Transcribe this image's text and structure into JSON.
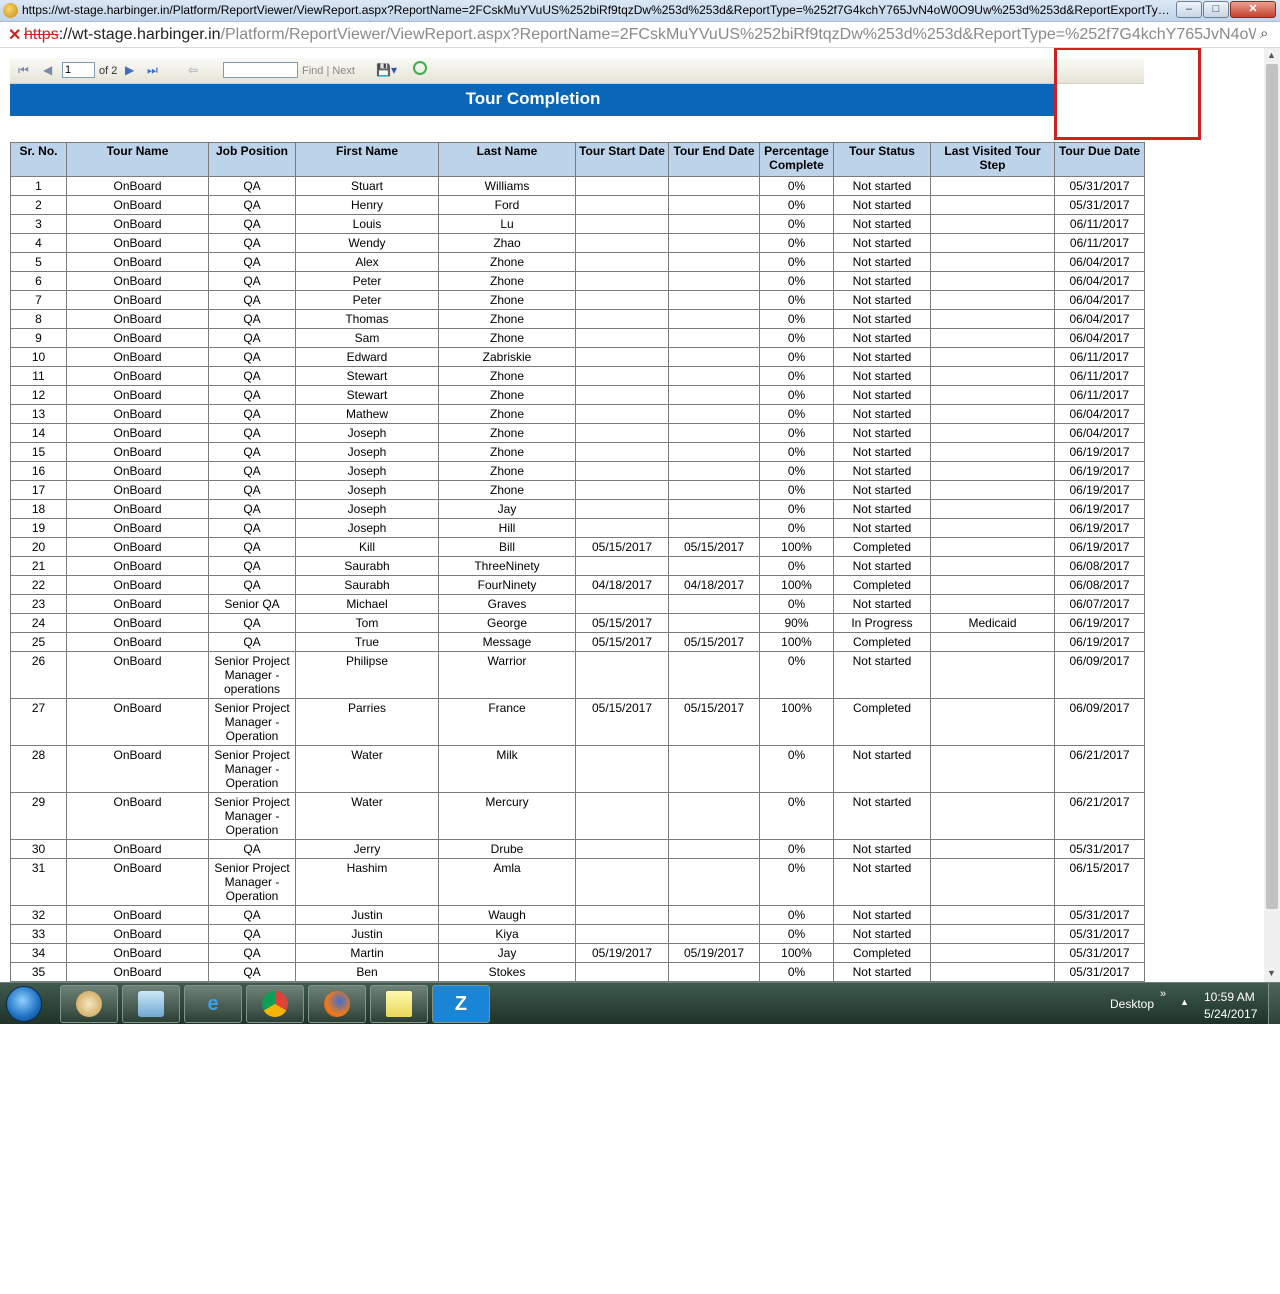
{
  "window": {
    "title": "https://wt-stage.harbinger.in/Platform/ReportViewer/ViewReport.aspx?ReportName=2FCskMuYVuUS%252biRf9tqzDw%253d%253d&ReportType=%252f7G4kchY765JvN4oW0O9Uw%253d%253d&ReportExportType...",
    "minimize": "–",
    "maximize": "□",
    "close": "✕"
  },
  "address_bar": {
    "scheme": "https",
    "host": "://wt-stage.harbinger.in",
    "path": "/Platform/ReportViewer/ViewReport.aspx?ReportName=2FCskMuYVuUS%252biRf9tqzDw%253d%253d&ReportType=%252f7G4kchY765JvN4oW0",
    "warning_icon": "certificate-error-icon",
    "zoom_icon": "magnifier-icon"
  },
  "toolbar": {
    "first": "⏮",
    "prev": "◀",
    "page_value": "1",
    "page_of": "of 2",
    "next": "▶",
    "last": "⏭",
    "back": "⇦",
    "find_next": "Find | Next",
    "export": "💾▾"
  },
  "report": {
    "title": "Tour Completion",
    "headers": [
      "Sr. No.",
      "Tour Name",
      "Job Position",
      "First Name",
      "Last Name",
      "Tour Start Date",
      "Tour End Date",
      "Percentage Complete",
      "Tour Status",
      "Last Visited Tour Step",
      "Tour Due Date"
    ],
    "rows": [
      [
        "1",
        "OnBoard",
        "QA",
        "Stuart",
        "Williams",
        "",
        "",
        "0%",
        "Not started",
        "",
        "05/31/2017"
      ],
      [
        "2",
        "OnBoard",
        "QA",
        "Henry",
        "Ford",
        "",
        "",
        "0%",
        "Not started",
        "",
        "05/31/2017"
      ],
      [
        "3",
        "OnBoard",
        "QA",
        "Louis",
        "Lu",
        "",
        "",
        "0%",
        "Not started",
        "",
        "06/11/2017"
      ],
      [
        "4",
        "OnBoard",
        "QA",
        "Wendy",
        "Zhao",
        "",
        "",
        "0%",
        "Not started",
        "",
        "06/11/2017"
      ],
      [
        "5",
        "OnBoard",
        "QA",
        "Alex",
        "Zhone",
        "",
        "",
        "0%",
        "Not started",
        "",
        "06/04/2017"
      ],
      [
        "6",
        "OnBoard",
        "QA",
        "Peter",
        "Zhone",
        "",
        "",
        "0%",
        "Not started",
        "",
        "06/04/2017"
      ],
      [
        "7",
        "OnBoard",
        "QA",
        "Peter",
        "Zhone",
        "",
        "",
        "0%",
        "Not started",
        "",
        "06/04/2017"
      ],
      [
        "8",
        "OnBoard",
        "QA",
        "Thomas",
        "Zhone",
        "",
        "",
        "0%",
        "Not started",
        "",
        "06/04/2017"
      ],
      [
        "9",
        "OnBoard",
        "QA",
        "Sam",
        "Zhone",
        "",
        "",
        "0%",
        "Not started",
        "",
        "06/04/2017"
      ],
      [
        "10",
        "OnBoard",
        "QA",
        "Edward",
        "Zabriskie",
        "",
        "",
        "0%",
        "Not started",
        "",
        "06/11/2017"
      ],
      [
        "11",
        "OnBoard",
        "QA",
        "Stewart",
        "Zhone",
        "",
        "",
        "0%",
        "Not started",
        "",
        "06/11/2017"
      ],
      [
        "12",
        "OnBoard",
        "QA",
        "Stewart",
        "Zhone",
        "",
        "",
        "0%",
        "Not started",
        "",
        "06/11/2017"
      ],
      [
        "13",
        "OnBoard",
        "QA",
        "Mathew",
        "Zhone",
        "",
        "",
        "0%",
        "Not started",
        "",
        "06/04/2017"
      ],
      [
        "14",
        "OnBoard",
        "QA",
        "Joseph",
        "Zhone",
        "",
        "",
        "0%",
        "Not started",
        "",
        "06/04/2017"
      ],
      [
        "15",
        "OnBoard",
        "QA",
        "Joseph",
        "Zhone",
        "",
        "",
        "0%",
        "Not started",
        "",
        "06/19/2017"
      ],
      [
        "16",
        "OnBoard",
        "QA",
        "Joseph",
        "Zhone",
        "",
        "",
        "0%",
        "Not started",
        "",
        "06/19/2017"
      ],
      [
        "17",
        "OnBoard",
        "QA",
        "Joseph",
        "Zhone",
        "",
        "",
        "0%",
        "Not started",
        "",
        "06/19/2017"
      ],
      [
        "18",
        "OnBoard",
        "QA",
        "Joseph",
        "Jay",
        "",
        "",
        "0%",
        "Not started",
        "",
        "06/19/2017"
      ],
      [
        "19",
        "OnBoard",
        "QA",
        "Joseph",
        "Hill",
        "",
        "",
        "0%",
        "Not started",
        "",
        "06/19/2017"
      ],
      [
        "20",
        "OnBoard",
        "QA",
        "Kill",
        "Bill",
        "05/15/2017",
        "05/15/2017",
        "100%",
        "Completed",
        "",
        "06/19/2017"
      ],
      [
        "21",
        "OnBoard",
        "QA",
        "Saurabh",
        "ThreeNinety",
        "",
        "",
        "0%",
        "Not started",
        "",
        "06/08/2017"
      ],
      [
        "22",
        "OnBoard",
        "QA",
        "Saurabh",
        "FourNinety",
        "04/18/2017",
        "04/18/2017",
        "100%",
        "Completed",
        "",
        "06/08/2017"
      ],
      [
        "23",
        "OnBoard",
        "Senior QA",
        "Michael",
        "Graves",
        "",
        "",
        "0%",
        "Not started",
        "",
        "06/07/2017"
      ],
      [
        "24",
        "OnBoard",
        "QA",
        "Tom",
        "George",
        "05/15/2017",
        "",
        "90%",
        "In Progress",
        "Medicaid",
        "06/19/2017"
      ],
      [
        "25",
        "OnBoard",
        "QA",
        "True",
        "Message",
        "05/15/2017",
        "05/15/2017",
        "100%",
        "Completed",
        "",
        "06/19/2017"
      ],
      [
        "26",
        "OnBoard",
        "Senior Project Manager - operations",
        "Philipse",
        "Warrior",
        "",
        "",
        "0%",
        "Not started",
        "",
        "06/09/2017"
      ],
      [
        "27",
        "OnBoard",
        "Senior Project Manager - Operation",
        "Parries",
        "France",
        "05/15/2017",
        "05/15/2017",
        "100%",
        "Completed",
        "",
        "06/09/2017"
      ],
      [
        "28",
        "OnBoard",
        "Senior Project Manager - Operation",
        "Water",
        "Milk",
        "",
        "",
        "0%",
        "Not started",
        "",
        "06/21/2017"
      ],
      [
        "29",
        "OnBoard",
        "Senior Project Manager - Operation",
        "Water",
        "Mercury",
        "",
        "",
        "0%",
        "Not started",
        "",
        "06/21/2017"
      ],
      [
        "30",
        "OnBoard",
        "QA",
        "Jerry",
        "Drube",
        "",
        "",
        "0%",
        "Not started",
        "",
        "05/31/2017"
      ],
      [
        "31",
        "OnBoard",
        "Senior Project Manager - Operation",
        "Hashim",
        "Amla",
        "",
        "",
        "0%",
        "Not started",
        "",
        "06/15/2017"
      ],
      [
        "32",
        "OnBoard",
        "QA",
        "Justin",
        "Waugh",
        "",
        "",
        "0%",
        "Not started",
        "",
        "05/31/2017"
      ],
      [
        "33",
        "OnBoard",
        "QA",
        "Justin",
        "Kiya",
        "",
        "",
        "0%",
        "Not started",
        "",
        "05/31/2017"
      ],
      [
        "34",
        "OnBoard",
        "QA",
        "Martin",
        "Jay",
        "05/19/2017",
        "05/19/2017",
        "100%",
        "Completed",
        "",
        "05/31/2017"
      ],
      [
        "35",
        "OnBoard",
        "QA",
        "Ben",
        "Stokes",
        "",
        "",
        "0%",
        "Not started",
        "",
        "05/31/2017"
      ]
    ]
  },
  "taskbar": {
    "apps": [
      "paint-icon",
      "file-explorer-icon",
      "internet-explorer-icon",
      "chrome-icon",
      "firefox-icon",
      "sticky-notes-icon",
      "zoho-icon"
    ],
    "ie_glyph": "e",
    "zoho_glyph": "Z",
    "desktop_label": "Desktop",
    "expand": "»",
    "tray_arrow": "▲",
    "time": "10:59 AM",
    "date": "5/24/2017"
  },
  "colors": {
    "report_title_bg": "#0a66b8",
    "header_bg": "#bcd3ea",
    "highlight_border": "#d0211c"
  }
}
